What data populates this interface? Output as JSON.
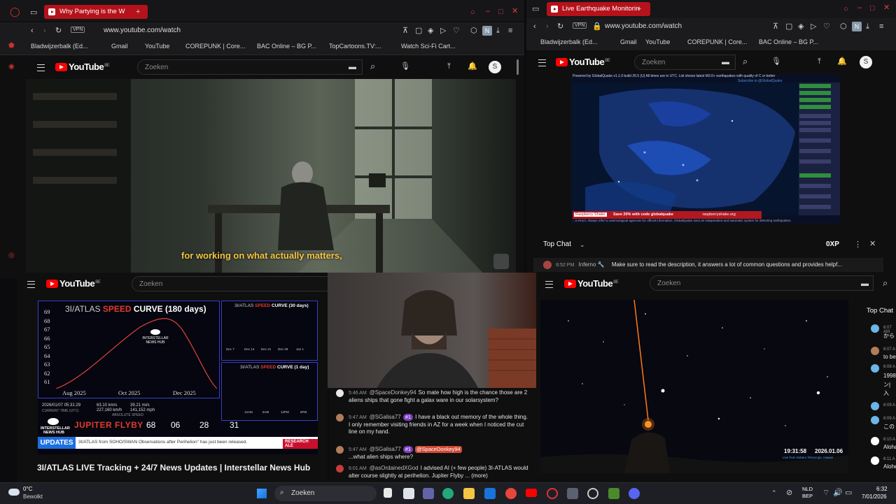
{
  "left_browser": {
    "tab_title": "Why Partying is the W",
    "url": "www.youtube.com/watch",
    "vpn_label": "VPN",
    "profile_initial": "N",
    "bookmarks": [
      "Bladwijzerbalk (Ed...",
      "Gmail",
      "YouTube",
      "COREPUNK | Core...",
      "BAC Online – BG P...",
      "TopCartoons.TV:...",
      "Watch Sci-Fi Cart..."
    ],
    "yt_logo": "YouTube",
    "yt_region": "BE",
    "search_placeholder": "Zoeken",
    "avatar_initial": "S",
    "subtitle": "for working on what actually matters,"
  },
  "right_browser": {
    "tab_title": "Live Earthquake Monitorin",
    "url": "www.youtube.com/watch",
    "vpn_label": "VPN",
    "profile_initial": "N",
    "bookmarks": [
      "Bladwijzerbalk (Ed...",
      "Gmail",
      "YouTube",
      "COREPUNK | Core...",
      "BAC Online – BG P..."
    ],
    "yt_logo": "YouTube",
    "yt_region": "BE",
    "search_placeholder": "Zoeken",
    "avatar_initial": "S",
    "map_header": "Powered by GlobalQuake v1.1.0 build 26.5 (U)    All times are in UTC.  List shows latest M3.0+ earthquakes with quality of C or better",
    "map_subscribe": "Subscribe to @GlobalQuake",
    "map_promo": "Save 20% with code globalquake",
    "map_promo_brand": "Raspberry Shake",
    "map_promo_url": "raspberryshake.org",
    "map_footer": "...s errors. Always refer to seismological agencies for official information. GlobalQuake uses an independent and automatic system for detecting earthquakes.",
    "top_chat_label": "Top Chat",
    "xp_label": "0XP",
    "chat_time": "6:52 PM",
    "chat_user": "Inferno",
    "chat_msg": "Make sure to read the description, it answers a lot of common questions and provides helpf..."
  },
  "bottom_left": {
    "yt_logo": "YouTube",
    "yt_region": "BE",
    "search_placeholder": "Zoeken",
    "chart_main_title_1": "3I/ATLAS",
    "chart_main_title_2": "SPEED",
    "chart_main_title_3": "CURVE (180 days)",
    "chart_y_ticks": [
      "69",
      "68",
      "67",
      "66",
      "65",
      "64",
      "63",
      "62",
      "61"
    ],
    "chart_x_ticks": [
      "Aug 2025",
      "Oct 2025",
      "Dec 2025"
    ],
    "chart30_title_1": "3I/ATLAS",
    "chart30_title_2": "SPEED",
    "chart30_title_3": "CURVE (30 days)",
    "chart30_x_ticks": [
      "Dec 7",
      "Dec 14",
      "Dec 21",
      "Dec 28",
      "Jan 1"
    ],
    "chart1_title_1": "3I/ATLAS",
    "chart1_title_2": "SPEED",
    "chart1_title_3": "CURVE (1 day)",
    "chart1_x_ticks": [
      "12AM",
      "6AM",
      "12PM",
      "6PM"
    ],
    "hub_name": "INTERSTELLAR",
    "hub_sub": "NEWS HUB",
    "datetime": "2026/01/07 05:31:29",
    "datetime_label": "CURRENT TIME (UTC)",
    "speed_1": "63.10 km/s",
    "speed_2": "227,160 km/h",
    "speed_3": "39.21 mi/s",
    "speed_4": "141,152 mph",
    "speed_label": "ABSOLUTE SPEED",
    "flyby_label": "JUPITER FLYBY",
    "countdown": [
      "68",
      "06",
      "28",
      "31"
    ],
    "updates_label": "UPDATES",
    "ticker": "3I/ATLAS from SOHO/SWAN Observations after Perihelion\" has just been released.",
    "research_label": "RESEARCH ALE",
    "video_title": "3I/ATLAS LIVE Tracking + 24/7 News Updates | Interstellar News Hub"
  },
  "middle_chat": {
    "messages": [
      {
        "time": "5:46 AM",
        "user": "@SpaceDonkey94",
        "text": "So mate how high is the chance those are 2 aliens ships that gone fight a galax ware in our solarsystem?"
      },
      {
        "time": "5:47 AM",
        "user": "@SGalisa77",
        "badge": "#1",
        "text": "I have a black out memory of the whole thing. I only remember visiting friends in AZ for a week when I noticed the cut line on my hand."
      },
      {
        "time": "5:47 AM",
        "user": "@SGalisa77",
        "badge": "#1",
        "mention": "@SpaceDonkey94",
        "text": "...what alien ships where?"
      },
      {
        "time": "6:01 AM",
        "user": "@asOrdainedXGod",
        "text": "I advised AI (+ few people) 3I-ATLAS would alter course slightly at perihelion. Jupiter Flyby ... (more)"
      }
    ]
  },
  "bottom_right": {
    "yt_logo": "YouTube",
    "yt_region": "BE",
    "search_placeholder": "Zoeken",
    "top_chat_label": "Top Chat",
    "overlay_time": "19:31:58",
    "overlay_date": "2026.01.06",
    "overlay_caption": "Live from Subaru Telescope, Hawaii",
    "chat_times": [
      "6:07 AM",
      "6:07 A",
      "6:08 A",
      "6:09 A",
      "6:09 A",
      "6:10 A",
      "6:11 A"
    ],
    "chat_snippets": [
      "から",
      "to be",
      "1998",
      "ン|",
      "入",
      "この",
      "Aloha",
      "Alohe"
    ]
  },
  "taskbar": {
    "weather_temp": "0°C",
    "weather_desc": "Bewolkt",
    "search_label": "Zoeken",
    "lang_1": "NLD",
    "lang_2": "BEP",
    "time": "6:32",
    "date": "7/01/2026"
  },
  "colors": {
    "accent_red": "#ff0000",
    "opera_red": "#b5121b",
    "chart_curve": "#e0413a",
    "updates_blue": "#1d6fe0"
  }
}
